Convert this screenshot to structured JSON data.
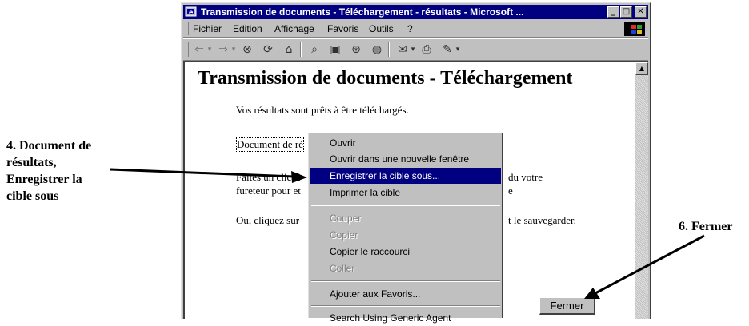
{
  "annotations": {
    "left_lines": [
      "4. Document de",
      "résultats,",
      "Enregistrer la",
      "cible sous"
    ],
    "right": "6. Fermer"
  },
  "window": {
    "title": "Transmission de documents - Téléchargement - résultats - Microsoft ...",
    "controls": {
      "minimize": "_",
      "maximize": "□",
      "close": "✕"
    }
  },
  "menubar": {
    "items": [
      {
        "label": "Fichier"
      },
      {
        "label": "Edition"
      },
      {
        "label": "Affichage"
      },
      {
        "label": "Favoris"
      },
      {
        "label": "Outils"
      },
      {
        "label": "?"
      }
    ]
  },
  "toolbar": {
    "icons": [
      "back-icon",
      "forward-icon",
      "stop-icon",
      "refresh-icon",
      "home-icon",
      "search-icon",
      "favorites-icon",
      "history-icon",
      "channels-icon",
      "mail-icon",
      "print-icon",
      "edit-icon"
    ]
  },
  "page": {
    "heading": "Transmission de documents - Téléchargement",
    "ready_text": "Vos résultats sont prêts à être téléchargés.",
    "link_text": "Document de ré",
    "instr_line1": "Faites un clic-d",
    "instr_line1_tail": "du votre",
    "instr_line2": "fureteur pour et",
    "or_text": "Ou, cliquez sur",
    "or_tail": "t le sauvegarder.",
    "fermer_label": "Fermer"
  },
  "context_menu": {
    "items": [
      {
        "label": "Ouvrir",
        "state": "normal"
      },
      {
        "label": "Ouvrir dans une nouvelle fenêtre",
        "state": "normal"
      },
      {
        "label": "Enregistrer la cible sous...",
        "state": "selected"
      },
      {
        "label": "Imprimer la cible",
        "state": "normal"
      },
      {
        "label": "Couper",
        "state": "disabled"
      },
      {
        "label": "Copier",
        "state": "disabled"
      },
      {
        "label": "Copier le raccourci",
        "state": "normal"
      },
      {
        "label": "Coller",
        "state": "disabled"
      },
      {
        "label": "Ajouter aux Favoris...",
        "state": "normal"
      },
      {
        "label": "Search Using Generic Agent",
        "state": "normal"
      }
    ]
  },
  "colors": {
    "titlebar": "#000080",
    "face": "#c0c0c0",
    "highlight": "#000080"
  }
}
